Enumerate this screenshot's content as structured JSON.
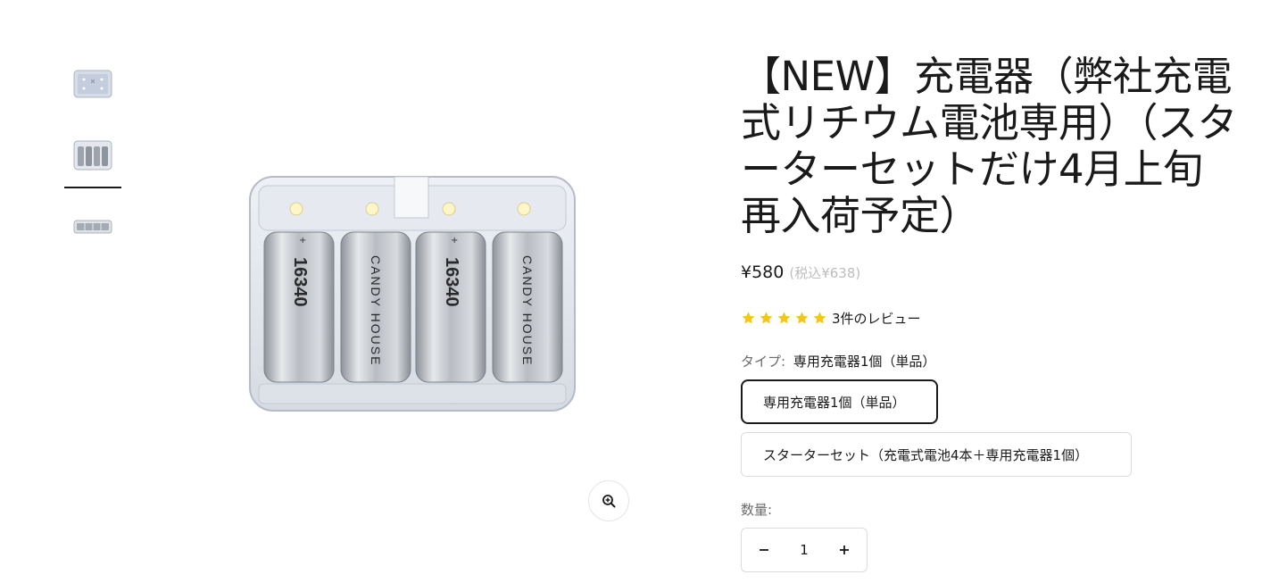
{
  "gallery": {
    "thumbnails": [
      {
        "alt": "charger-top-view"
      },
      {
        "alt": "charger-with-batteries"
      },
      {
        "alt": "charger-side-view"
      }
    ],
    "selected_index": 1,
    "zoom_icon": "zoom-in-icon",
    "battery_labels": [
      "16340",
      "CANDY HOUSE",
      "16340",
      "CANDY HOUSE"
    ]
  },
  "product": {
    "title": "【NEW】充電器（弊社充電式リチウム電池専用）（スターターセットだけ4月上旬再入荷予定）",
    "price": "¥580",
    "price_tax": "(税込¥638)",
    "rating": 5,
    "review_text": "3件のレビュー",
    "type_label": "タイプ:",
    "type_value": "専用充電器1個（単品）",
    "options": [
      {
        "label": "専用充電器1個（単品）",
        "selected": true
      },
      {
        "label": "スターターセット（充電式電池4本＋専用充電器1個）",
        "selected": false
      }
    ],
    "quantity_label": "数量:",
    "quantity": "1"
  },
  "colors": {
    "star": "#f5c518",
    "text": "#1a1a1a",
    "muted": "#6b6b6b",
    "border": "#dcdcdc"
  }
}
